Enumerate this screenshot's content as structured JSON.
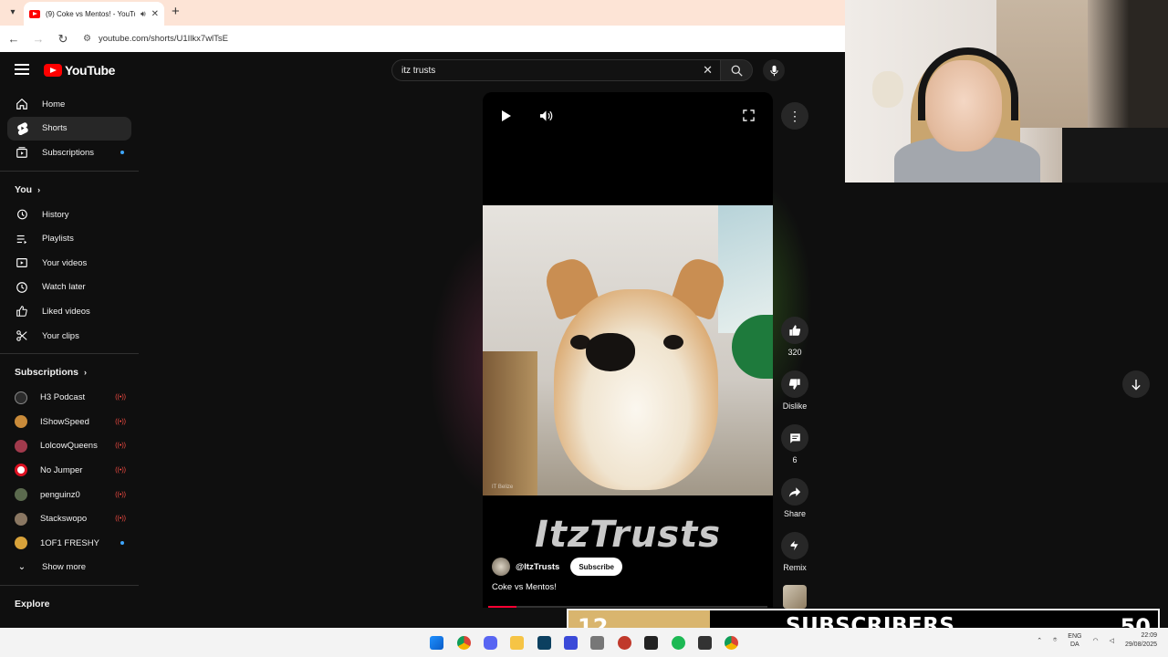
{
  "browser": {
    "tab_title": "(9) Coke vs Mentos! - YouTube",
    "url": "youtube.com/shorts/U1Ilkx7wlTsE"
  },
  "header": {
    "logo_text": "YouTube",
    "search_query": "itz trusts"
  },
  "sidebar": {
    "main": [
      {
        "label": "Home",
        "icon": "home-icon"
      },
      {
        "label": "Shorts",
        "icon": "shorts-icon"
      },
      {
        "label": "Subscriptions",
        "icon": "subscriptions-icon"
      }
    ],
    "you_heading": "You",
    "you_items": [
      {
        "label": "History",
        "icon": "history-icon"
      },
      {
        "label": "Playlists",
        "icon": "playlists-icon"
      },
      {
        "label": "Your videos",
        "icon": "your-videos-icon"
      },
      {
        "label": "Watch later",
        "icon": "watch-later-icon"
      },
      {
        "label": "Liked videos",
        "icon": "liked-videos-icon"
      },
      {
        "label": "Your clips",
        "icon": "scissors-icon"
      }
    ],
    "subscriptions_heading": "Subscriptions",
    "channels": [
      {
        "label": "H3 Podcast",
        "status": "live"
      },
      {
        "label": "IShowSpeed",
        "status": "live"
      },
      {
        "label": "LolcowQueens",
        "status": "live"
      },
      {
        "label": "No Jumper",
        "status": "live"
      },
      {
        "label": "penguinz0",
        "status": "live"
      },
      {
        "label": "Stackswopo",
        "status": "live"
      },
      {
        "label": "1OF1 FRESHY",
        "status": "new"
      }
    ],
    "show_more": "Show more",
    "explore_heading": "Explore"
  },
  "short": {
    "overlay_text": "ItzTrusts",
    "video_watermark": "IT Belize",
    "channel_handle": "@ItzTrusts",
    "subscribe_label": "Subscribe",
    "title": "Coke vs Mentos!",
    "progress": 0.1
  },
  "actions": {
    "like_count": "320",
    "dislike_label": "Dislike",
    "comment_count": "6",
    "share_label": "Share",
    "remix_label": "Remix"
  },
  "stream_overlay": {
    "current_subs": "12",
    "label": "SUBSCRIBERS",
    "goal": "50",
    "progress": 0.24,
    "bar_color": "#d9b56e"
  },
  "taskbar": {
    "lang_top": "ENG",
    "lang_bottom": "DA",
    "time": "22:09",
    "date": "29/08/2025"
  },
  "colors": {
    "yt_red": "#ff0000",
    "live_red": "#ff4e45",
    "new_dot": "#3ea6ff",
    "background": "#0f0f0f"
  }
}
